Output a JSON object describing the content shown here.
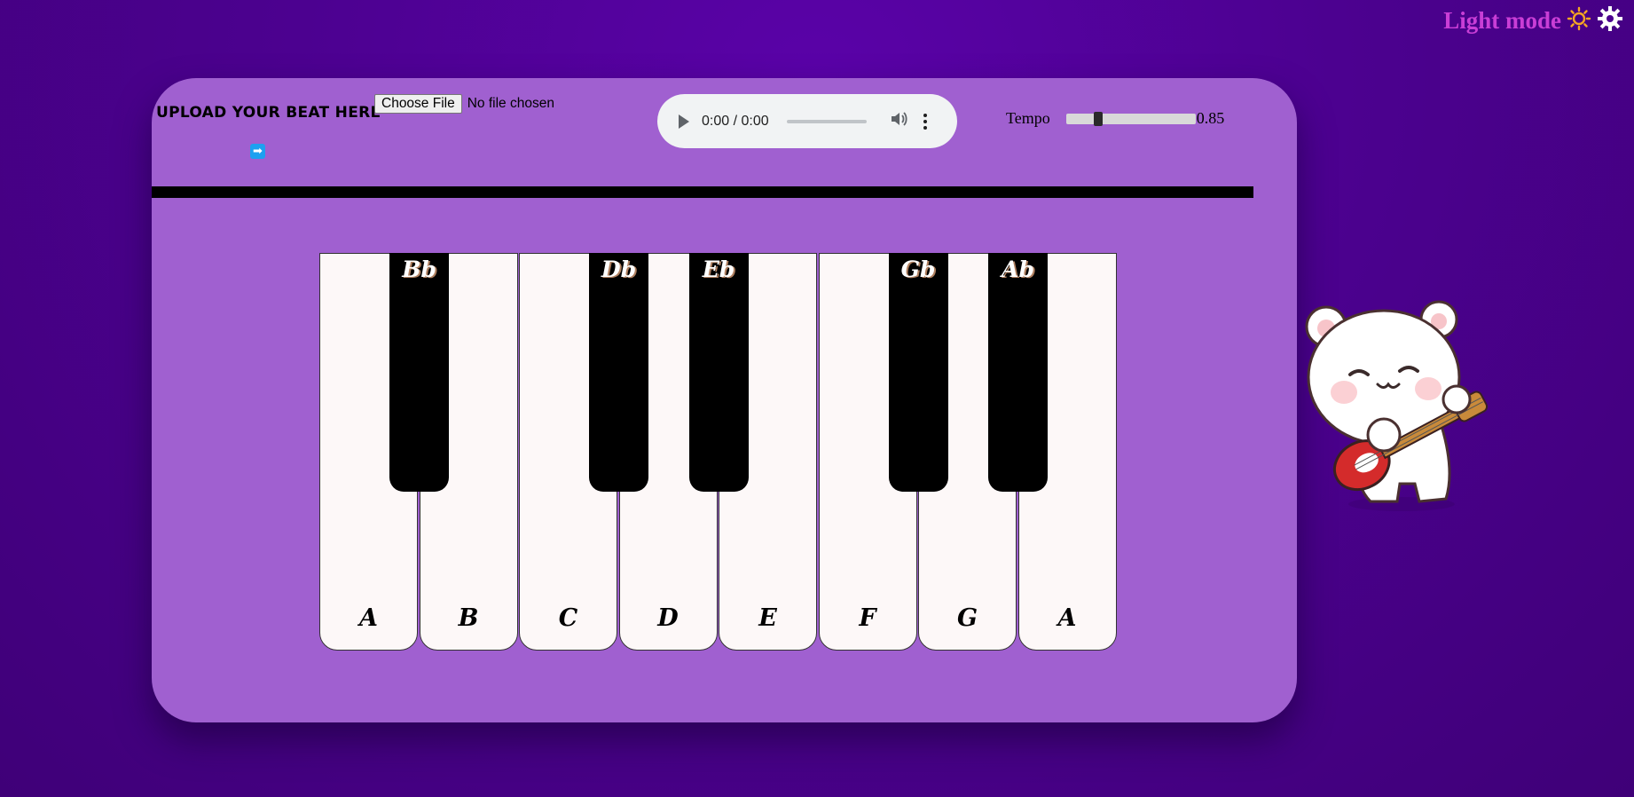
{
  "mode_toggle": {
    "label": "Light mode",
    "icons": [
      "sun-icon",
      "gear-icon"
    ],
    "color": "#c93ed6"
  },
  "upload": {
    "label": "Upload your beat here",
    "choose_button": "Choose File",
    "file_status": "No file chosen",
    "submit_icon": "arrow-right-icon",
    "submit_glyph": "➡"
  },
  "audio_player": {
    "time": "0:00 / 0:00",
    "icons": [
      "play-icon",
      "volume-icon",
      "more-options-icon"
    ]
  },
  "tempo": {
    "label": "Tempo",
    "value_text": "0.85",
    "position": 0.25
  },
  "piano": {
    "white_keys": [
      "A",
      "B",
      "C",
      "D",
      "E",
      "F",
      "G",
      "A"
    ],
    "black_keys": [
      "Bb",
      "Db",
      "Eb",
      "Gb",
      "Ab"
    ]
  },
  "colors": {
    "background": "#4c0190",
    "panel": "#a060d0",
    "accent_label": "#c93ed6"
  },
  "mascot": "bear-guitar-illustration"
}
